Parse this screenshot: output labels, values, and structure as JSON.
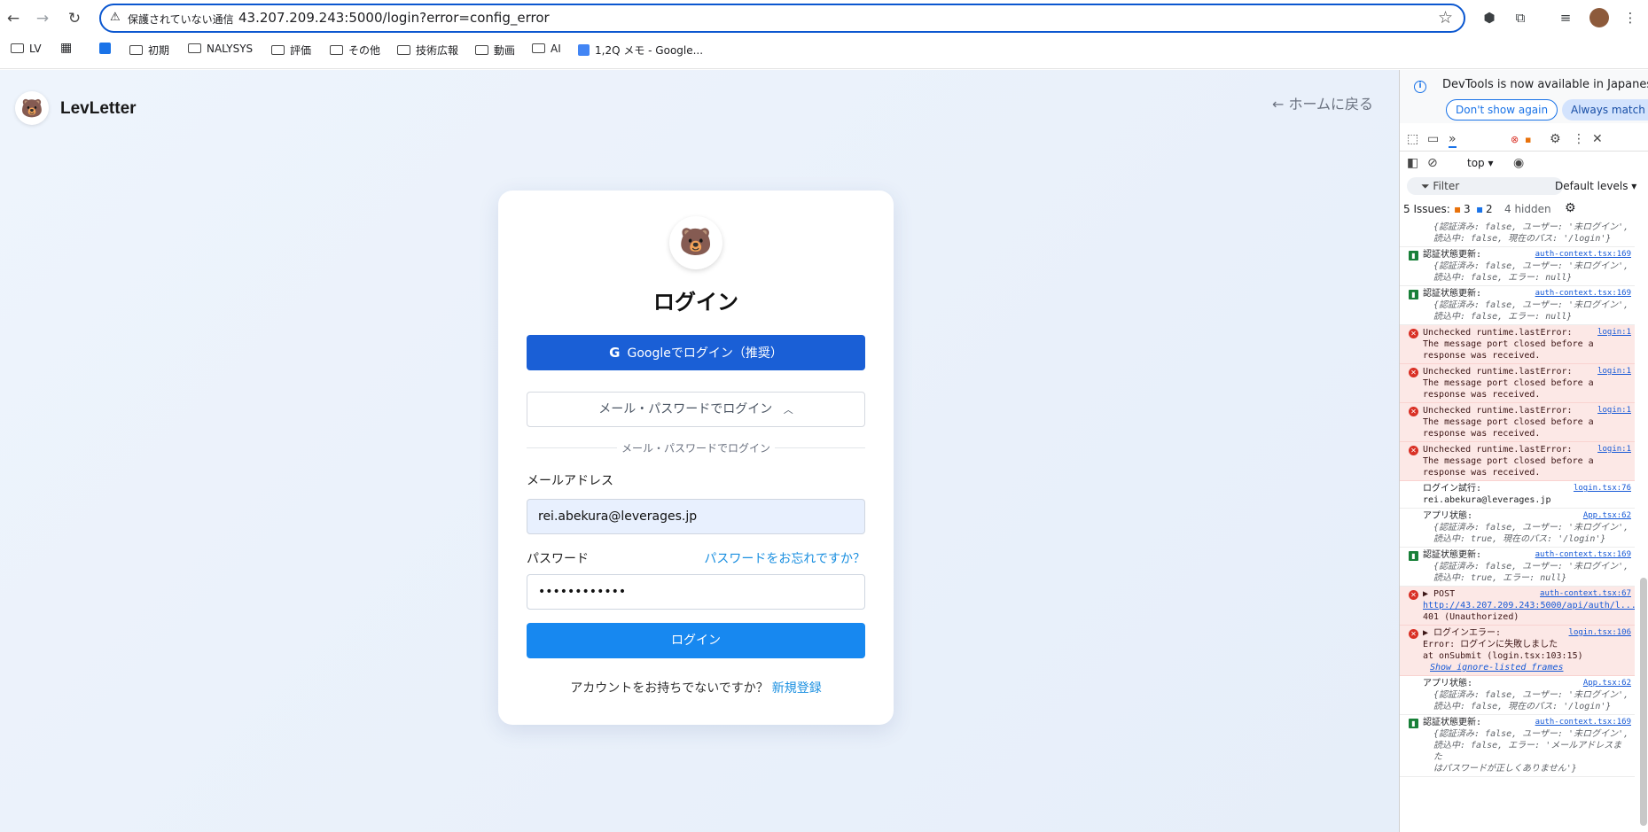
{
  "browser": {
    "security_label": "保護されていない通信",
    "url": "43.207.209.243:5000/login?error=config_error",
    "bookmarks": [
      "LV",
      "",
      "初期",
      "NALYSYS",
      "評価",
      "その他",
      "技術広報",
      "動画",
      "AI",
      "1,2Q メモ - Google..."
    ]
  },
  "header": {
    "brand": "LevLetter",
    "home_link": "← ホームに戻る"
  },
  "login": {
    "title": "ログイン",
    "google_button": "Googleでログイン（推奨）",
    "email_toggle": "メール・パスワードでログイン",
    "divider": "メール・パスワードでログイン",
    "email_label": "メールアドレス",
    "email_value": "rei.abekura@leverages.jp",
    "password_label": "パスワード",
    "forgot": "パスワードをお忘れですか？",
    "password_value": "••••••••••••",
    "submit": "ログイン",
    "signup_prompt": "アカウントをお持ちでないですか？",
    "signup_link": "新規登録"
  },
  "devtools": {
    "notice": "DevTools is now available in Japanese",
    "dont_show": "Don't show again",
    "always_match": "Always match Chrome's language",
    "context": "top ▾",
    "filter": "Filter",
    "levels": "Default levels ▾",
    "issues_label": "5 Issues:",
    "issues_warn": "3",
    "issues_info": "2",
    "hidden": "4 hidden",
    "log": [
      {
        "type": "obj",
        "title": "",
        "source": "",
        "lines": [
          "{認証済み: false, ユーザー: '未ログイン',",
          "読込中: false, 現在のパス: '/login'}"
        ]
      },
      {
        "type": "stat",
        "title": "認証状態更新:",
        "source": "auth-context.tsx:169",
        "lines": [
          "{認証済み: false, ユーザー: '未ログイン',",
          "読込中: false, エラー: null}"
        ]
      },
      {
        "type": "stat",
        "title": "認証状態更新:",
        "source": "auth-context.tsx:169",
        "lines": [
          "{認証済み: false, ユーザー: '未ログイン',",
          "読込中: false, エラー: null}"
        ]
      },
      {
        "type": "err",
        "title": "Unchecked runtime.lastError:",
        "source": "login:1",
        "lines": [
          "The message port closed before a",
          "response was received."
        ]
      },
      {
        "type": "err",
        "title": "Unchecked runtime.lastError:",
        "source": "login:1",
        "lines": [
          "The message port closed before a",
          "response was received."
        ]
      },
      {
        "type": "err",
        "title": "Unchecked runtime.lastError:",
        "source": "login:1",
        "lines": [
          "The message port closed before a",
          "response was received."
        ]
      },
      {
        "type": "err",
        "title": "Unchecked runtime.lastError:",
        "source": "login:1",
        "lines": [
          "The message port closed before a",
          "response was received."
        ]
      },
      {
        "type": "plain",
        "title": "ログイン試行:",
        "source": "login.tsx:76",
        "lines": [
          "rei.abekura@leverages.jp"
        ]
      },
      {
        "type": "plain",
        "title": "アプリ状態:",
        "source": "App.tsx:62",
        "lines": [
          "{認証済み: false, ユーザー: '未ログイン',",
          "読込中: true, 現在のパス: '/login'}"
        ]
      },
      {
        "type": "stat",
        "title": "認証状態更新:",
        "source": "auth-context.tsx:169",
        "lines": [
          "{認証済み: false, ユーザー: '未ログイン',",
          "読込中: true, エラー: null}"
        ]
      },
      {
        "type": "err",
        "title": "▶ POST",
        "source": "auth-context.tsx:67",
        "lines": [
          "http://43.207.209.243:5000/api/auth/l...",
          "401 (Unauthorized)"
        ]
      },
      {
        "type": "err",
        "title": "▶ ログインエラー:",
        "source": "login.tsx:106",
        "lines": [
          "Error: ログインに失敗しました",
          "    at onSubmit (login.tsx:103:15)",
          "Show ignore-listed frames"
        ]
      },
      {
        "type": "plain",
        "title": "アプリ状態:",
        "source": "App.tsx:62",
        "lines": [
          "{認証済み: false, ユーザー: '未ログイン',",
          "読込中: false, 現在のパス: '/login'}"
        ]
      },
      {
        "type": "stat",
        "title": "認証状態更新:",
        "source": "auth-context.tsx:169",
        "lines": [
          "{認証済み: false, ユーザー: '未ログイン',",
          "読込中: false, エラー: 'メールアドレスまた",
          "はパスワードが正しくありません'}"
        ]
      }
    ]
  }
}
